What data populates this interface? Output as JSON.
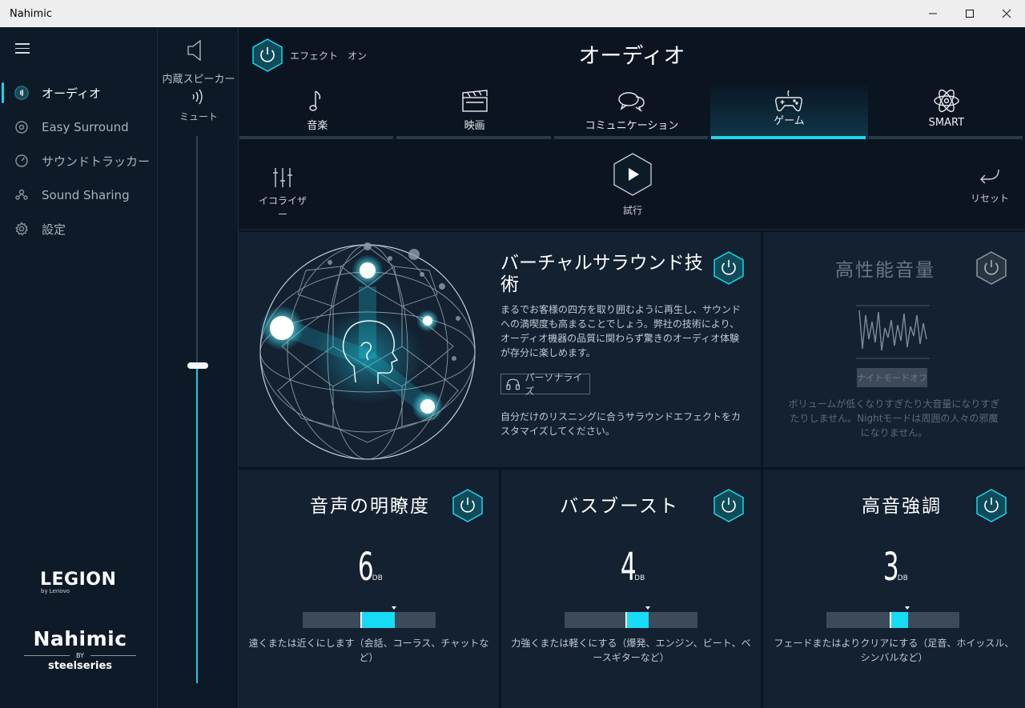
{
  "window": {
    "title": "Nahimic"
  },
  "sidebar": {
    "items": [
      {
        "label": "オーディオ",
        "icon": "audio-waves-icon",
        "active": true
      },
      {
        "label": "Easy Surround",
        "icon": "surround-icon",
        "active": false
      },
      {
        "label": "サウンドトラッカー",
        "icon": "sound-tracker-icon",
        "active": false
      },
      {
        "label": "Sound Sharing",
        "icon": "sound-sharing-icon",
        "active": false
      },
      {
        "label": "設定",
        "icon": "gear-icon",
        "active": false
      }
    ],
    "brand": {
      "legion": "LEGION",
      "legion_sub": "by Lenovo",
      "nahimic": "Nahimic",
      "by": "BY",
      "steelseries": "steelseries"
    }
  },
  "volume": {
    "device_label": "内蔵スピーカー",
    "mute_label": "ミュート",
    "level": 0.58
  },
  "main": {
    "effect_label": "エフェクト　オン",
    "title": "オーディオ",
    "tabs": [
      {
        "label": "音楽",
        "icon": "music-note-icon",
        "active": false
      },
      {
        "label": "映画",
        "icon": "clapperboard-icon",
        "active": false
      },
      {
        "label": "コミュニケーション",
        "icon": "chat-bubbles-icon",
        "active": false
      },
      {
        "label": "ゲーム",
        "icon": "gamepad-icon",
        "active": true
      },
      {
        "label": "SMART",
        "icon": "atom-icon",
        "active": false
      }
    ],
    "toolbar": {
      "equalizer_label": "イコライザー",
      "play_label": "試行",
      "reset_label": "リセット"
    },
    "virtual_surround": {
      "title": "バーチャルサラウンド技術",
      "description": "まるでお客様の四方を取り囲むように再生し、サウンドへの満喫度も高まることでしょう。弊社の技術により、オーディオ機器の品質に関わらず驚きのオーディオ体験が存分に楽しめます。",
      "personalize_label": "パーソナライズ",
      "note": "自分だけのリスニングに合うサラウンドエフェクトをカスタマイズしてください。"
    },
    "high_performance": {
      "title": "高性能音量",
      "night_mode_label": "ナイトモードオフ",
      "description": "ボリュームが低くなりすぎたり大音量になりすぎたりしません。Nightモードは周囲の人々の邪魔になりません。"
    },
    "settings": [
      {
        "title": "音声の明瞭度",
        "value": "6",
        "unit": "DB",
        "level": 0.5,
        "description": "遠くまたは近くにします（会話、コーラス、チャットなど）"
      },
      {
        "title": "バスブースト",
        "value": "4",
        "unit": "DB",
        "level": 0.5,
        "description": "力強くまたは軽くにする（爆発、エンジン、ビート、ベースギターなど）"
      },
      {
        "title": "高音強調",
        "value": "3",
        "unit": "DB",
        "level": 0.5,
        "description": "フェードまたはよりクリアにする（足音、ホイッスル、シンバルなど）"
      }
    ]
  },
  "colors": {
    "accent": "#1fd3ea",
    "background": "#0b1522",
    "card": "#132131"
  }
}
